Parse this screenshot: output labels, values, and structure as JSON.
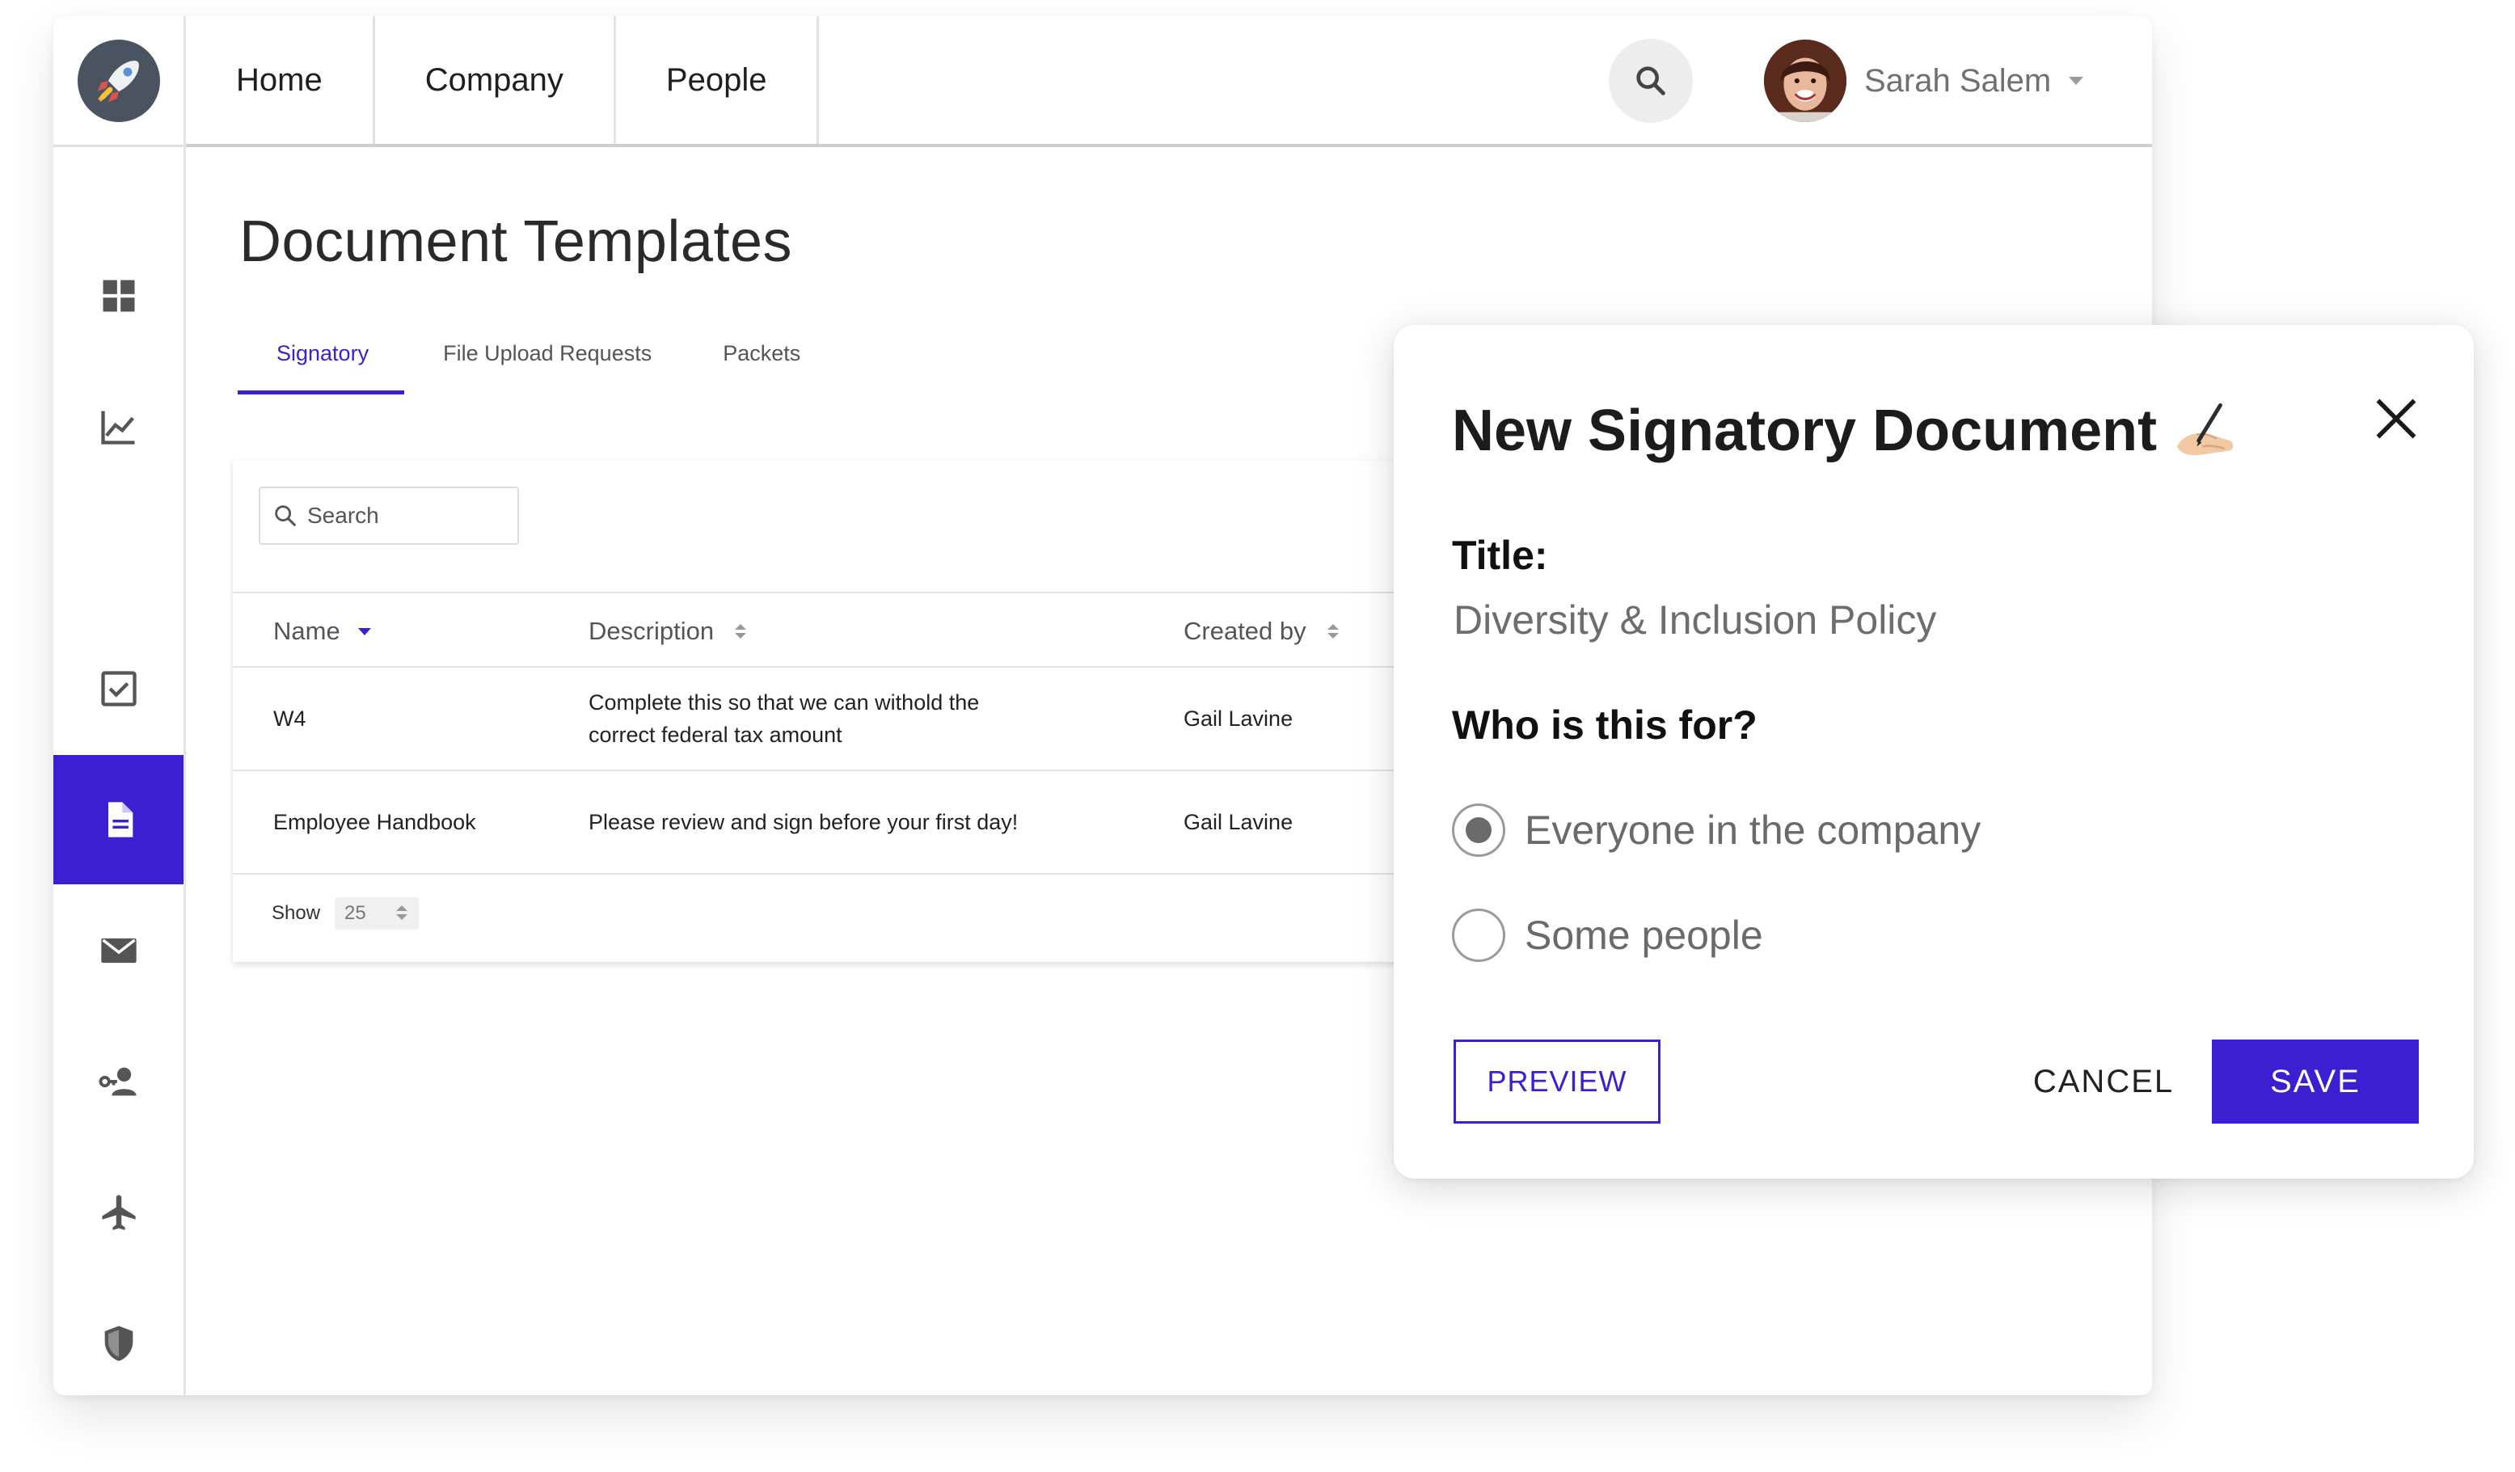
{
  "colors": {
    "accent": "#3b1fd1",
    "rail_active_bg": "#3b1fd1"
  },
  "logo": {
    "icon": "rocket-icon"
  },
  "rail": {
    "items": [
      {
        "icon": "dashboard-icon",
        "active": false
      },
      {
        "icon": "analytics-chart-icon",
        "active": false
      },
      {
        "icon": "checkbox-task-icon",
        "active": false
      },
      {
        "icon": "document-icon",
        "active": true
      },
      {
        "icon": "mail-icon",
        "active": false
      },
      {
        "icon": "key-user-icon",
        "active": false
      },
      {
        "icon": "airplane-icon",
        "active": false
      },
      {
        "icon": "shield-icon",
        "active": false
      }
    ]
  },
  "topnav": {
    "items": [
      {
        "label": "Home"
      },
      {
        "label": "Company"
      },
      {
        "label": "People"
      }
    ]
  },
  "header": {
    "search_icon": "search-icon",
    "user_name": "Sarah Salem"
  },
  "page": {
    "title": "Document Templates"
  },
  "tabs": [
    {
      "label": "Signatory",
      "active": true
    },
    {
      "label": "File Upload Requests"
    },
    {
      "label": "Packets"
    }
  ],
  "table": {
    "search_placeholder": "Search",
    "columns": [
      {
        "label": "Name"
      },
      {
        "label": "Description"
      },
      {
        "label": "Created by"
      }
    ],
    "rows": [
      {
        "name": "W4",
        "description": "Complete this so that we can withold the correct federal tax amount",
        "created_by": "Gail Lavine"
      },
      {
        "name": "Employee Handbook",
        "description": "Please review and sign before your first day!",
        "created_by": "Gail Lavine"
      }
    ],
    "show_label": "Show",
    "page_size": "25"
  },
  "modal": {
    "title": "New Signatory Document",
    "title_icon": "writing-hand-icon",
    "title_label": "Title:",
    "title_value": "Diversity & Inclusion Policy",
    "audience_label": "Who is this for?",
    "options": [
      {
        "label": "Everyone in the company",
        "checked": true
      },
      {
        "label": "Some people",
        "checked": false
      }
    ],
    "preview_label": "PREVIEW",
    "cancel_label": "CANCEL",
    "save_label": "SAVE"
  }
}
